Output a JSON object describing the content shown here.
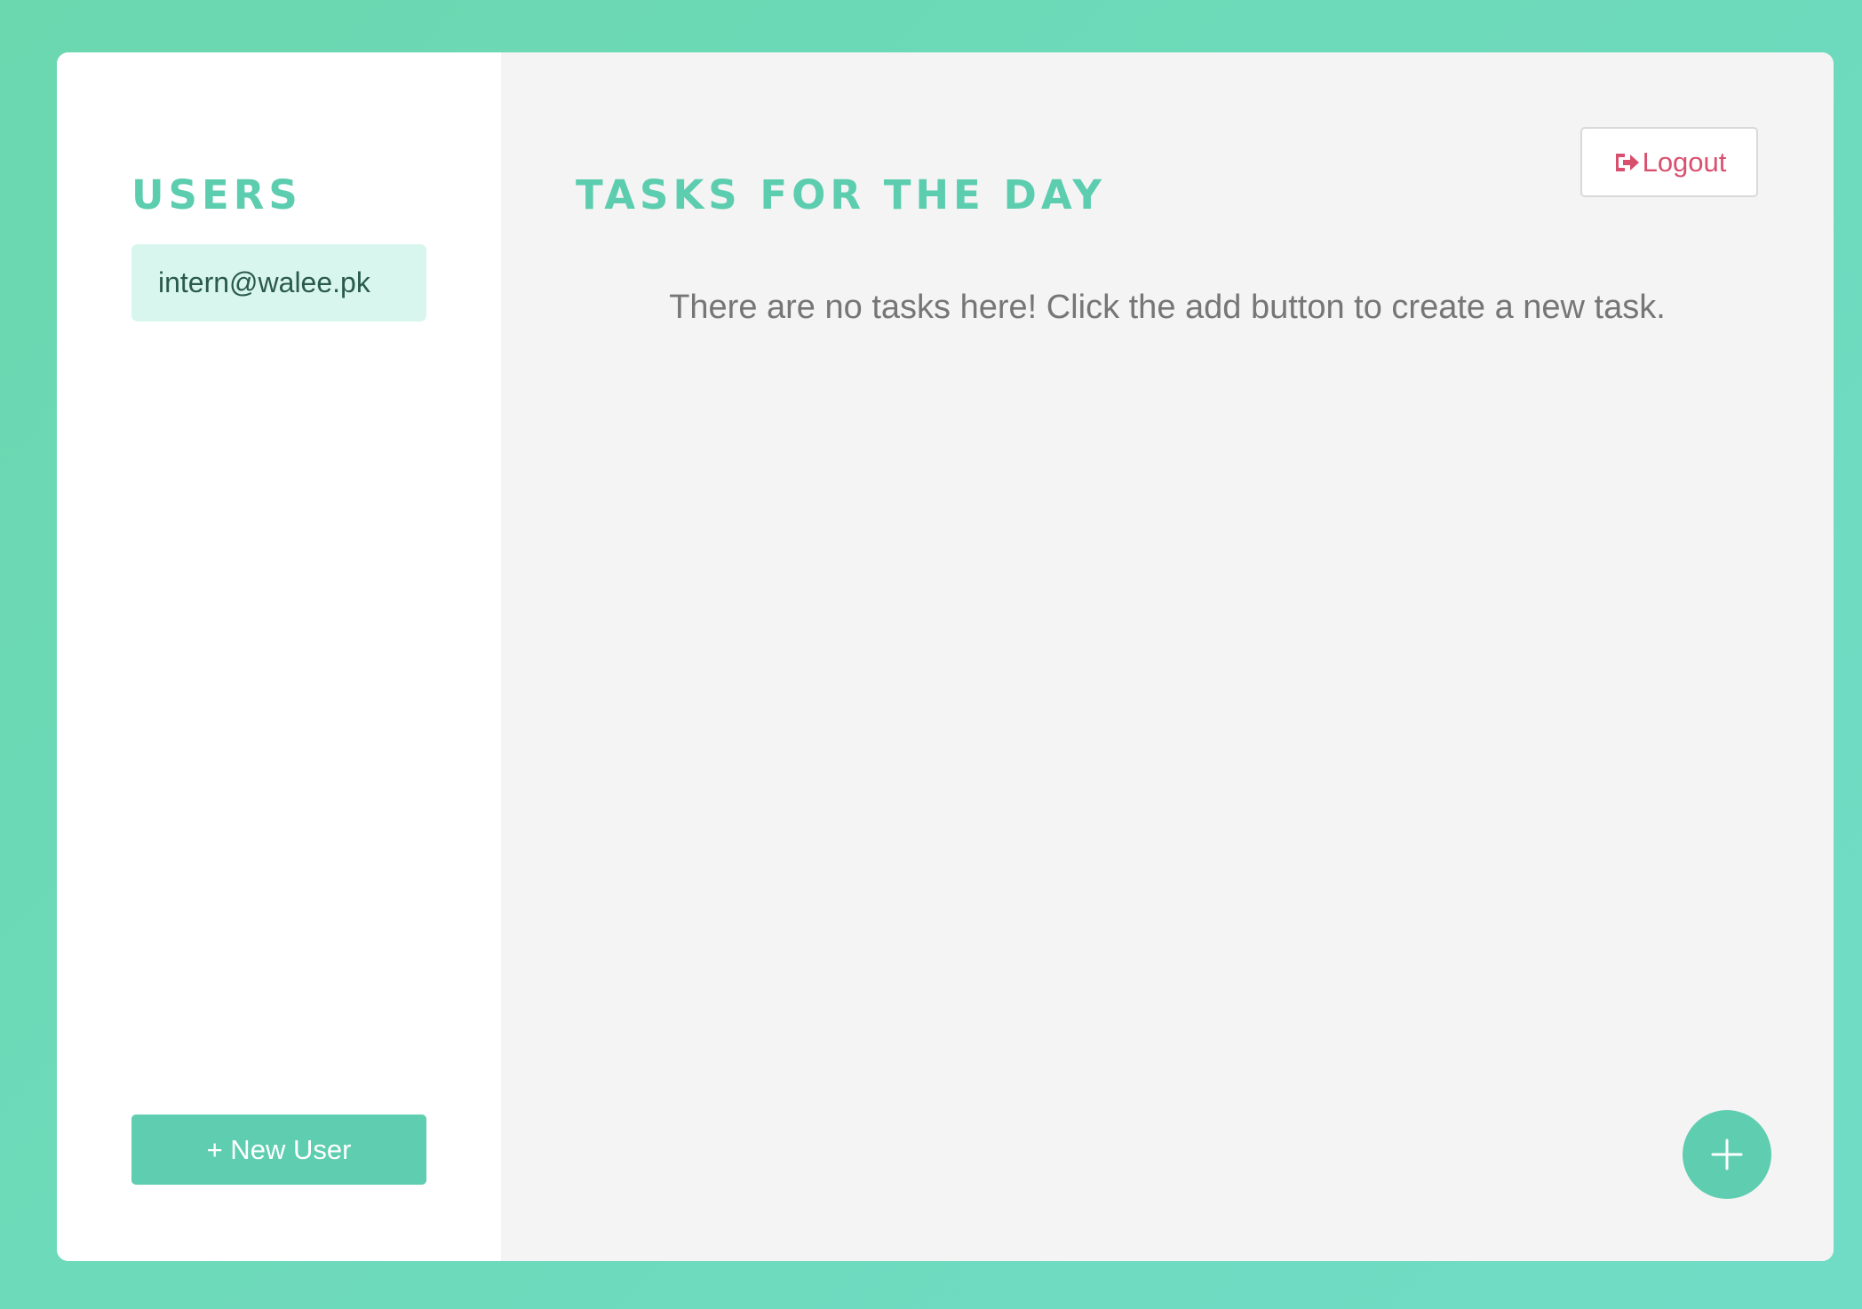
{
  "sidebar": {
    "title": "USERS",
    "users": [
      "intern@walee.pk"
    ],
    "new_user_label": "+ New User"
  },
  "main": {
    "title": "TASKS FOR THE DAY",
    "logout_label": "Logout",
    "empty_message": "There are no tasks here! Click the add button to create a new task.",
    "add_icon": "plus-icon",
    "logout_icon": "sign-out-icon"
  },
  "colors": {
    "background": "#6bd8b0",
    "accent": "#5ecdb0",
    "user_item_bg": "#d8f6ee",
    "logout_text": "#d9506e"
  }
}
